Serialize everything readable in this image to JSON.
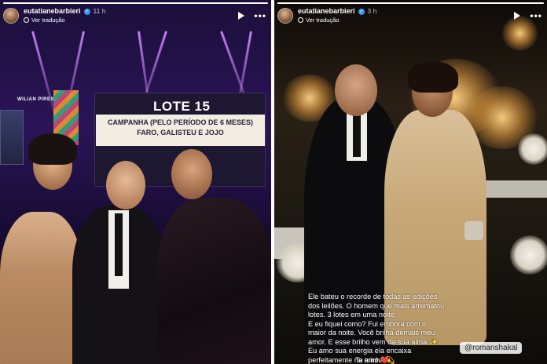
{
  "stories": [
    {
      "username": "eutatianebarbieri",
      "time": "11 h",
      "translate_label": "Ver tradução",
      "progress": 1.0,
      "stage": {
        "brand": "WILIAN PIRES",
        "lot_title": "LOTE 15",
        "campaign_line1": "CAMPANHA (PELO PERÍODO DE 6 MESES)",
        "campaign_line2": "FARO, GALISTEU E JOJO"
      }
    },
    {
      "username": "eutatianebarbieri",
      "time": "3 h",
      "translate_label": "Ver tradução",
      "progress": 1.0,
      "caption_lines": [
        "Ele bateu o recorde de todas as edições",
        "dos leilões. O homem que mais arrematou",
        "lotes. 3 lotes em uma noite.",
        "E eu fiquei como? Fui embora com o",
        "maior da noite. Você brilha demais meu",
        "amor. E esse brilho vem da sua alma ✨",
        "Eu amo sua energia ela encaixa",
        "perfeitamente na minha 💫"
      ],
      "mention": "@romanshakal",
      "love_text": "Te amo ❤️"
    }
  ],
  "colors": {
    "verified": "#3897f0",
    "stage_purple": "#2a1457",
    "gala_gold": "#c9a872"
  },
  "icons": [
    "avatar",
    "verified-badge-icon",
    "globe-icon",
    "play-icon",
    "more-options-icon"
  ]
}
